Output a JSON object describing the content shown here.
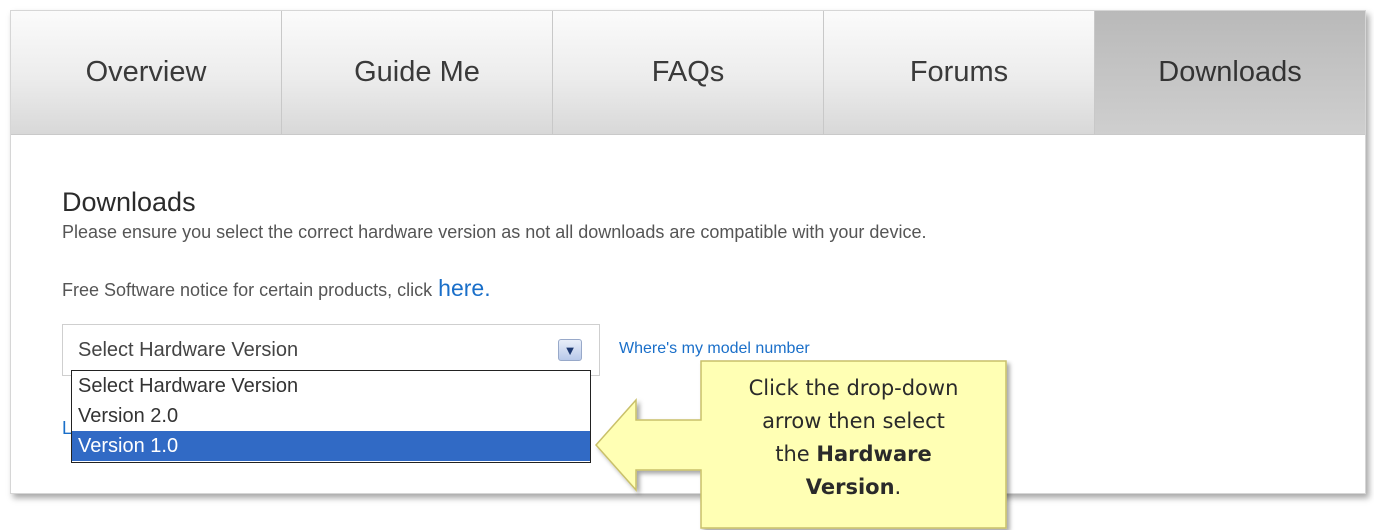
{
  "tabs": [
    {
      "label": "Overview",
      "active": false
    },
    {
      "label": "Guide Me",
      "active": false
    },
    {
      "label": "FAQs",
      "active": false
    },
    {
      "label": "Forums",
      "active": false
    },
    {
      "label": "Downloads",
      "active": true
    }
  ],
  "downloads": {
    "title": "Downloads",
    "description": "Please ensure you select the correct hardware version as not all downloads are compatible with your device.",
    "notice_prefix": "Free Software notice for certain products, click",
    "notice_link": "here",
    "notice_suffix": ".",
    "select": {
      "current_value": "Select Hardware Version",
      "options": [
        "Select Hardware Version",
        "Version 2.0",
        "Version 1.0"
      ],
      "highlighted_option": "Version 1.0"
    },
    "model_link": "Where's my model number",
    "obscured_link_fragment": "L"
  },
  "callout": {
    "line1": "Click the drop-down",
    "line2": "arrow then select",
    "line3_prefix": "the",
    "line3_bold": "Hardware",
    "line4_bold": "Version",
    "line4_suffix": "."
  },
  "colors": {
    "link": "#1a6fc9",
    "highlight": "#316ac5",
    "callout_fill": "#ffffb4",
    "callout_stroke": "#c9c06a"
  }
}
